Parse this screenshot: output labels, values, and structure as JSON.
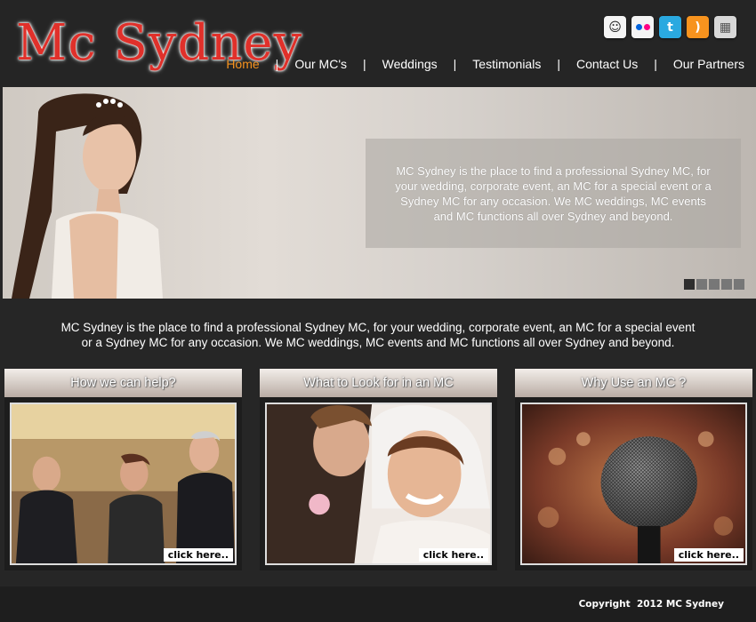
{
  "header": {
    "logo": "Mc Sydney",
    "social": [
      {
        "name": "reddit-icon",
        "glyph": "☺"
      },
      {
        "name": "flickr-icon",
        "glyph": ""
      },
      {
        "name": "twitter-icon",
        "glyph": "t"
      },
      {
        "name": "rss-icon",
        "glyph": ")"
      },
      {
        "name": "delicious-icon",
        "glyph": "▦"
      }
    ],
    "nav": [
      {
        "label": "Home",
        "active": true
      },
      {
        "label": "Our MC's"
      },
      {
        "label": "Weddings"
      },
      {
        "label": "Testimonials"
      },
      {
        "label": "Contact Us"
      },
      {
        "label": "Our Partners"
      }
    ],
    "nav_separator": "|"
  },
  "banner": {
    "text": "MC Sydney is the place to find a professional Sydney MC, for your wedding, corporate event, an MC for a special event or a Sydney MC for any occasion. We MC weddings, MC events and MC functions all over Sydney and beyond.",
    "slides_total": 5,
    "slide_active": 1
  },
  "intro": {
    "line1": "MC Sydney is the place to find a professional Sydney MC, for your wedding, corporate event, an MC for a special event",
    "line2": "or a Sydney MC for any occasion. We MC weddings, MC events and MC functions all over Sydney and beyond."
  },
  "cards": [
    {
      "title": "How we can help?",
      "link": "click here.."
    },
    {
      "title": "What to Look for in an MC",
      "link": "click here.."
    },
    {
      "title": "Why Use an MC ?",
      "link": "click here.."
    }
  ],
  "footer": {
    "copyright": "Copyright  2012 MC Sydney"
  },
  "colors": {
    "logo": "#e0302a",
    "nav_active": "#f7931e",
    "background": "#262626"
  }
}
